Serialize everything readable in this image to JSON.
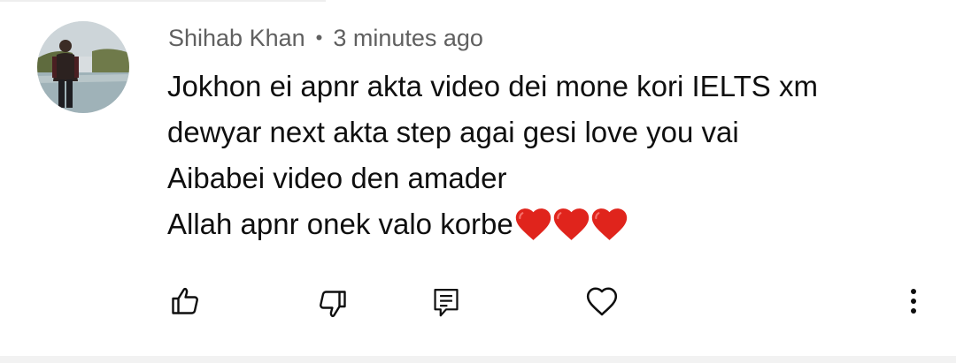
{
  "comment": {
    "author": "Shihab Khan",
    "separator": "•",
    "time": "3 minutes ago",
    "lines": [
      "Jokhon ei apnr akta video dei mone kori IELTS xm",
      "dewyar next akta step agai gesi love you vai",
      "Aibabei video den amader",
      "Allah apnr onek valo korbe"
    ],
    "emoji": [
      "red-heart",
      "red-heart",
      "red-heart"
    ]
  },
  "actions": {
    "icons": [
      "thumbs-up-icon",
      "thumbs-down-icon",
      "reply-icon",
      "heart-icon",
      "more-vert-icon"
    ]
  },
  "colors": {
    "text_primary": "#0f0f0f",
    "text_secondary": "#606060",
    "heart": "#e0241c",
    "icon": "#0f0f0f"
  }
}
